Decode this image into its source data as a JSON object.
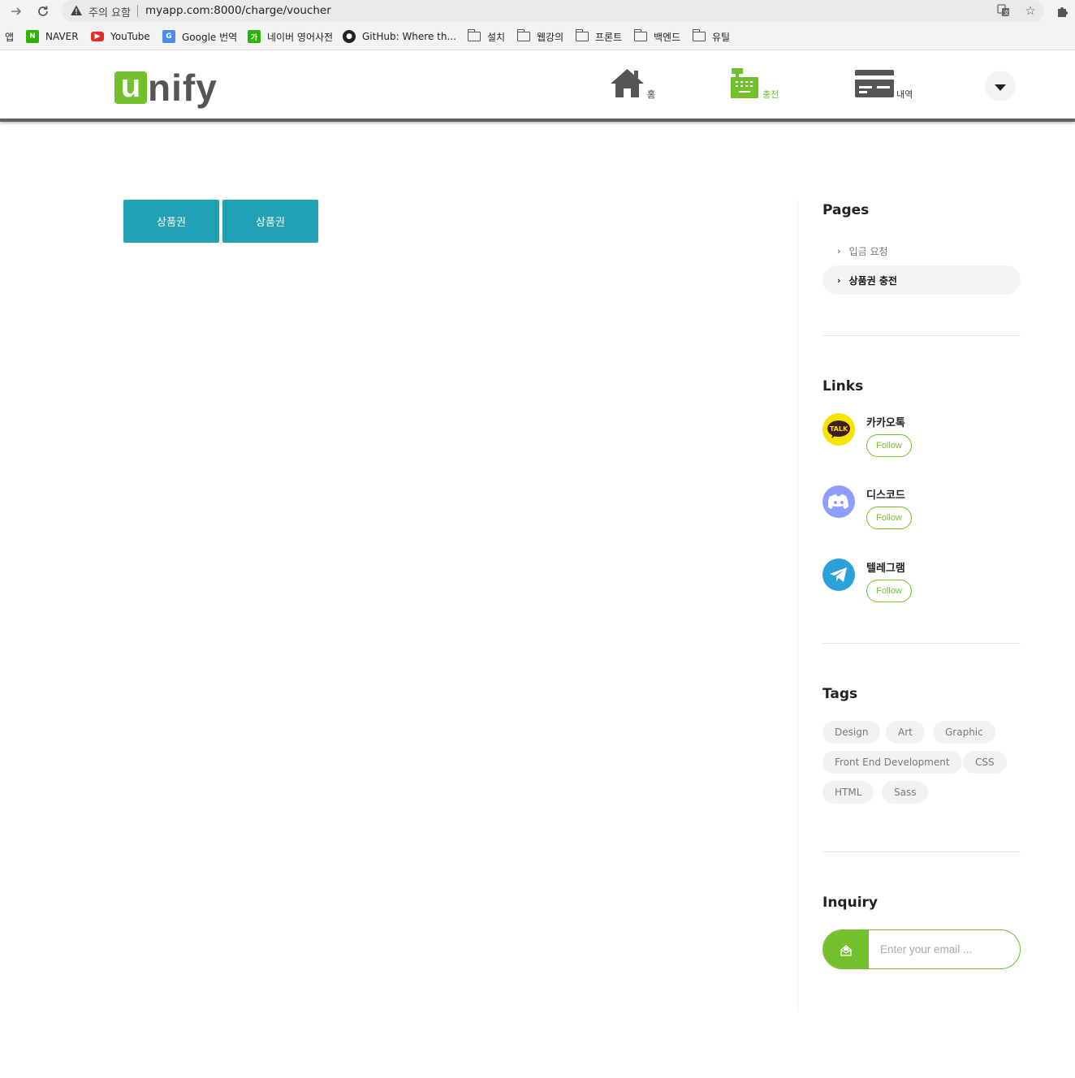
{
  "browser": {
    "security_label": "주의 요함",
    "url": "myapp.com:8000/charge/voucher",
    "bookmarks": {
      "apps": "앱",
      "naver": "NAVER",
      "youtube": "YouTube",
      "google_translate": "Google 번역",
      "naver_dict": "네이버 영어사전",
      "github": "GitHub: Where th...",
      "folder_install": "설치",
      "folder_lecture": "웹강의",
      "folder_front": "프론트",
      "folder_back": "백엔드",
      "folder_util": "유틸"
    }
  },
  "header": {
    "logo_first": "u",
    "logo_rest": "nify",
    "menu": {
      "home": "홈",
      "charge": "충전",
      "history": "내역"
    }
  },
  "main": {
    "voucher_buttons": [
      "상품권",
      "상품권"
    ]
  },
  "sidebar": {
    "pages_title": "Pages",
    "pages": [
      "입금 요청",
      "상품권 충전"
    ],
    "links_title": "Links",
    "links": [
      {
        "name": "카카오톡",
        "follow": "Follow"
      },
      {
        "name": "디스코드",
        "follow": "Follow"
      },
      {
        "name": "텔레그램",
        "follow": "Follow"
      }
    ],
    "kakao_badge": "TALK",
    "tags_title": "Tags",
    "tags": [
      "Design",
      "Art",
      "Graphic",
      "Front End Development",
      "CSS",
      "HTML",
      "Sass"
    ],
    "inquiry_title": "Inquiry",
    "inquiry_placeholder": "Enter your email ..."
  },
  "colors": {
    "brand_green": "#72c02c",
    "voucher_teal": "#22a1b4",
    "kakao_yellow": "#fbe300",
    "discord_blurple": "#8c9eff",
    "telegram_blue": "#2aa1da"
  }
}
